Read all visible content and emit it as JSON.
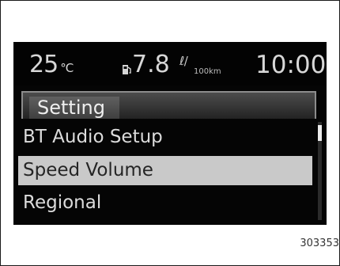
{
  "status_bar": {
    "temperature": "25",
    "temperature_unit": "°C",
    "fuel_icon": "fuel-pump-icon",
    "fuel_economy": "7.8",
    "fuel_unit_top": "ℓ/",
    "fuel_unit_bottom": "100km",
    "clock": "10:00"
  },
  "menu": {
    "title": "Setting",
    "items": [
      {
        "label": "BT Audio Setup"
      },
      {
        "label": "Speed Volume",
        "selected": true
      },
      {
        "label": "Regional"
      }
    ],
    "scroll_position": 0.04,
    "scroll_thumb_fraction": 0.16
  },
  "figure_code": "303353"
}
